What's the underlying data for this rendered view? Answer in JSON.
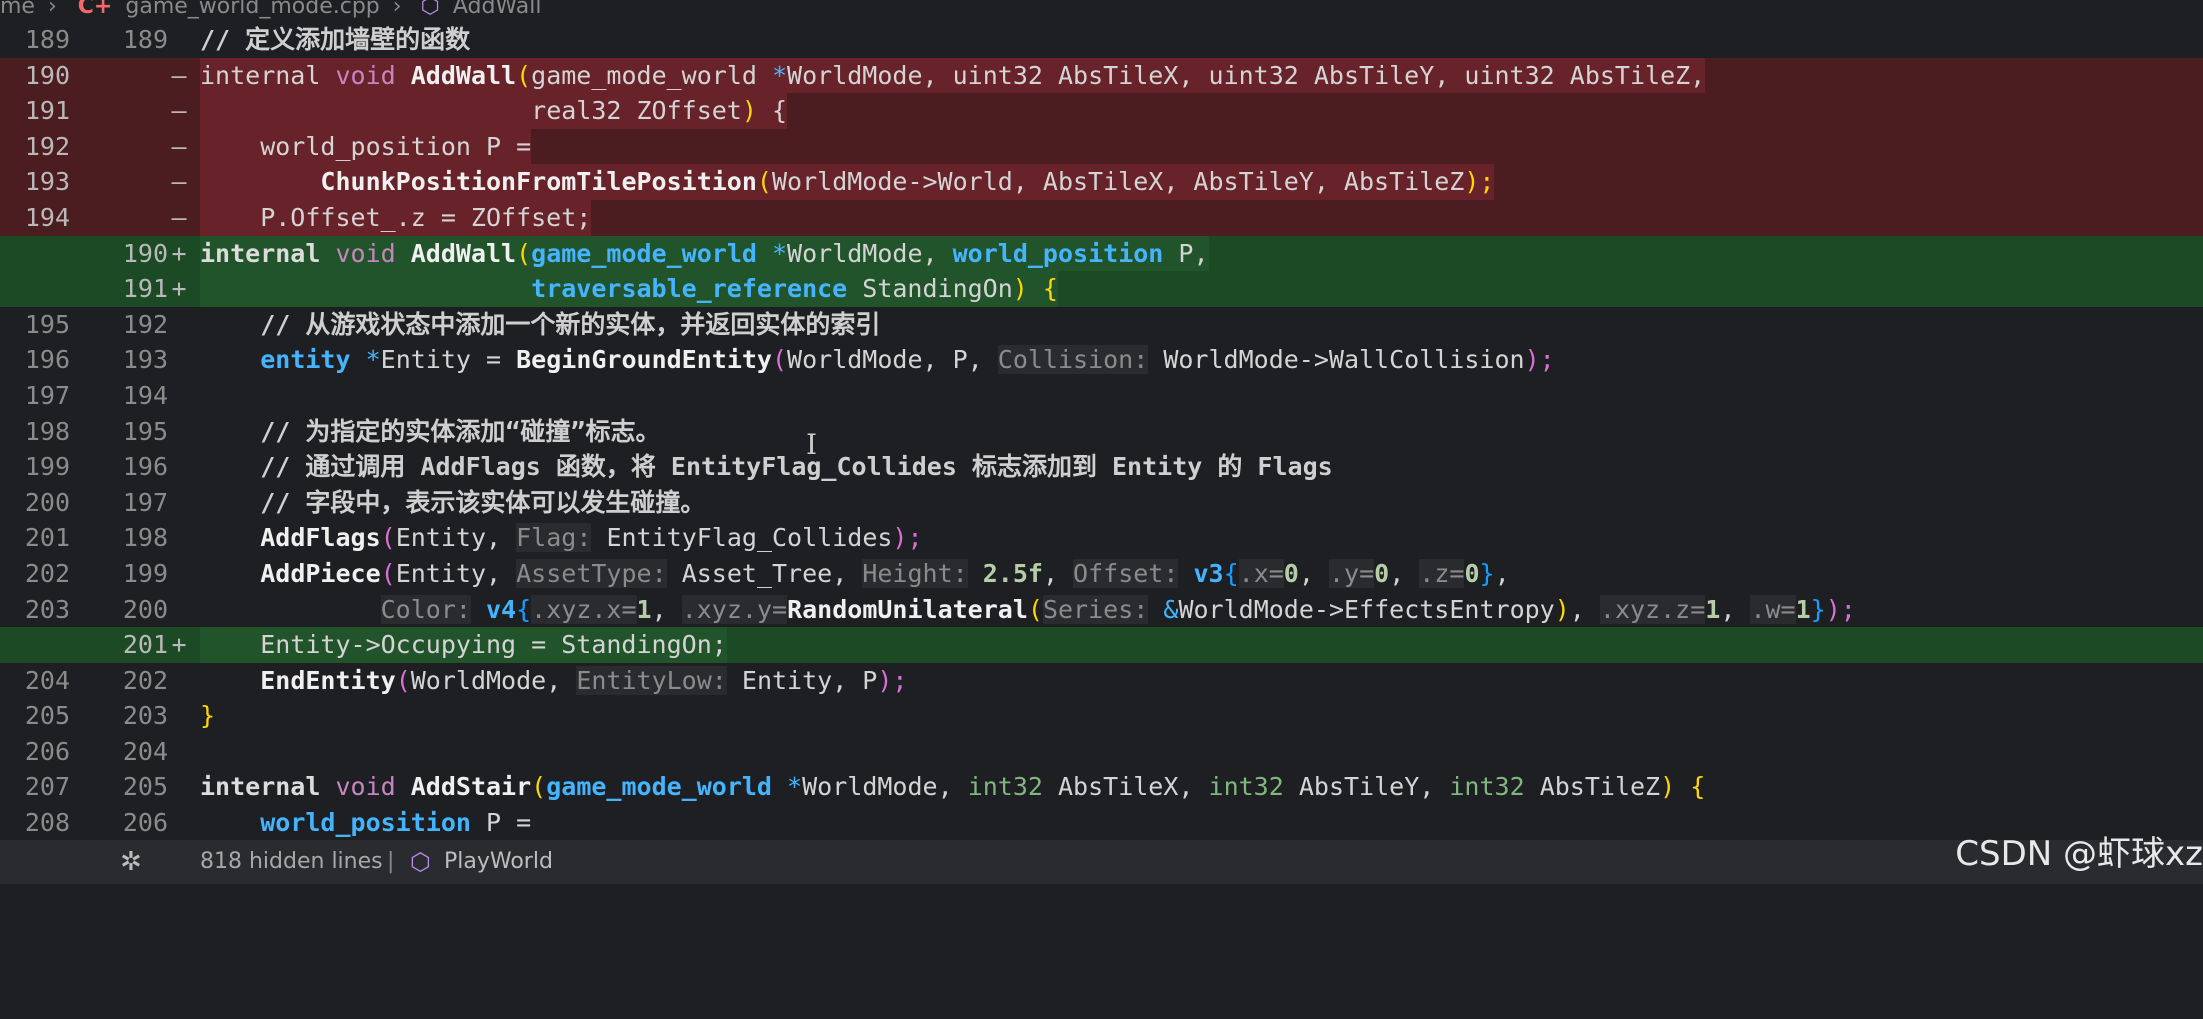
{
  "breadcrumb": {
    "prefix": "me",
    "sep1": "›",
    "file_icon": "C+",
    "file": "game_world_mode.cpp",
    "sep2": "›",
    "symbol": "AddWall"
  },
  "lines": [
    {
      "old": "189",
      "new": "189",
      "mark": "",
      "type": "ctx"
    },
    {
      "old": "190",
      "new": "",
      "mark": "—",
      "type": "del"
    },
    {
      "old": "191",
      "new": "",
      "mark": "—",
      "type": "del"
    },
    {
      "old": "192",
      "new": "",
      "mark": "—",
      "type": "del"
    },
    {
      "old": "193",
      "new": "",
      "mark": "—",
      "type": "del"
    },
    {
      "old": "194",
      "new": "",
      "mark": "—",
      "type": "del"
    },
    {
      "old": "",
      "new": "190",
      "mark": "+",
      "type": "add"
    },
    {
      "old": "",
      "new": "191",
      "mark": "+",
      "type": "add"
    },
    {
      "old": "195",
      "new": "192",
      "mark": "",
      "type": "ctx"
    },
    {
      "old": "196",
      "new": "193",
      "mark": "",
      "type": "ctx"
    },
    {
      "old": "197",
      "new": "194",
      "mark": "",
      "type": "ctx"
    },
    {
      "old": "198",
      "new": "195",
      "mark": "",
      "type": "ctx"
    },
    {
      "old": "199",
      "new": "196",
      "mark": "",
      "type": "ctx"
    },
    {
      "old": "200",
      "new": "197",
      "mark": "",
      "type": "ctx"
    },
    {
      "old": "201",
      "new": "198",
      "mark": "",
      "type": "ctx"
    },
    {
      "old": "202",
      "new": "199",
      "mark": "",
      "type": "ctx"
    },
    {
      "old": "203",
      "new": "200",
      "mark": "",
      "type": "ctx"
    },
    {
      "old": "",
      "new": "201",
      "mark": "+",
      "type": "add"
    },
    {
      "old": "204",
      "new": "202",
      "mark": "",
      "type": "ctx"
    },
    {
      "old": "205",
      "new": "203",
      "mark": "",
      "type": "ctx"
    },
    {
      "old": "206",
      "new": "204",
      "mark": "",
      "type": "ctx"
    },
    {
      "old": "207",
      "new": "205",
      "mark": "",
      "type": "ctx"
    },
    {
      "old": "208",
      "new": "206",
      "mark": "",
      "type": "ctx"
    }
  ],
  "code": {
    "l0": {
      "t0": "// 定义添加墙壁的函数"
    },
    "l1": {
      "t0": "internal",
      "t1": " void ",
      "t2": "AddWall",
      "t3": "(",
      "t4": "game_mode_world ",
      "t5": "*",
      "t6": "WorldMode, ",
      "t7": "uint32",
      "t8": " AbsTileX, ",
      "t9": "uint32",
      "t10": " AbsTileY, ",
      "t11": "uint32",
      "t12": " AbsTileZ,"
    },
    "l2": {
      "t0": "                      ",
      "t1": "real32",
      "t2": " ZOffset",
      "t3": ")",
      "t4": " {"
    },
    "l3": {
      "t0": "    world_position P ="
    },
    "l4": {
      "t0": "        ",
      "t1": "ChunkPositionFromTilePosition",
      "t2": "(",
      "t3": "WorldMode->World, AbsTileX, AbsTileY, AbsTileZ",
      "t4": ");"
    },
    "l5": {
      "t0": "    P.Offset_.z = ZOffset;"
    },
    "l6": {
      "t0": "internal",
      "t1": " void ",
      "t2": "AddWall",
      "t3": "(",
      "t4": "game_mode_world ",
      "t5": "*",
      "t6": "WorldMode, ",
      "t7": "world_position",
      "t8": " P,"
    },
    "l7": {
      "t0": "                      ",
      "t1": "traversable_reference",
      "t2": " StandingOn",
      "t3": ")",
      "t4": " {"
    },
    "l8": {
      "t0": "    // 从游戏状态中添加一个新的实体，并返回实体的索引"
    },
    "l9": {
      "t0": "    ",
      "t1": "entity ",
      "t2": "*",
      "t3": "Entity = ",
      "t4": "BeginGroundEntity",
      "t5": "(",
      "t6": "WorldMode, P, ",
      "t7": "Collision:",
      "t8": " WorldMode->WallCollision",
      "t9": ");"
    },
    "l10": {
      "t0": ""
    },
    "l11": {
      "t0": "    // 为指定的实体添加“碰撞”标志。"
    },
    "l12": {
      "t0": "    // 通过调用 AddFlags 函数，将 EntityFlag_Collides 标志添加到 Entity 的 Flags"
    },
    "l13": {
      "t0": "    // 字段中，表示该实体可以发生碰撞。"
    },
    "l14": {
      "t0": "    ",
      "t1": "AddFlags",
      "t2": "(",
      "t3": "Entity, ",
      "t4": "Flag:",
      "t5": " EntityFlag_Collides",
      "t6": ");"
    },
    "l15": {
      "t0": "    ",
      "t1": "AddPiece",
      "t2": "(",
      "t3": "Entity, ",
      "t4": "AssetType:",
      "t5": " Asset_Tree, ",
      "t6": "Height:",
      "t7": " 2.5f",
      "t8": ", ",
      "t9": "Offset:",
      "t10": " ",
      "t11": "v3",
      "t12": "{",
      "t13": ".x=",
      "t14": "0",
      ", ": "",
      "t15": ", ",
      "t16": ".y=",
      "t17": "0",
      "t18": ", ",
      "t19": ".z=",
      "t20": "0",
      "t21": "}",
      ",": "",
      "t22": ","
    },
    "l16": {
      "t0": "            ",
      "t1": "Color:",
      "t2": " ",
      "t3": "v4",
      "t4": "{",
      "t5": ".xyz.x=",
      "t6": "1",
      "t7": ", ",
      "t8": ".xyz.y=",
      "t9": "RandomUnilateral",
      "t10": "(",
      "t11": "Series:",
      "t12": " ",
      "t13": "&",
      "t14": "WorldMode->EffectsEntropy",
      "t15": ")",
      "t16": ", ",
      "t17": ".xyz.z=",
      "t18": "1",
      "t19": ", ",
      "t20": ".w=",
      "t21": "1",
      "t22": "}",
      "t23": ");"
    },
    "l17": {
      "t0": "    Entity->Occupying = StandingOn;"
    },
    "l18": {
      "t0": "    ",
      "t1": "EndEntity",
      "t2": "(",
      "t3": "WorldMode, ",
      "t4": "EntityLow:",
      "t5": " Entity, P",
      "t6": ");"
    },
    "l19": {
      "t0": "}"
    },
    "l20": {
      "t0": ""
    },
    "l21": {
      "t0": "internal",
      "t1": " void ",
      "t2": "AddStair",
      "t3": "(",
      "t4": "game_mode_world ",
      "t5": "*",
      "t6": "WorldMode, ",
      "t7": "int32",
      "t8": " AbsTileX, ",
      "t9": "int32",
      "t10": " AbsTileY, ",
      "t11": "int32",
      "t12": " AbsTileZ",
      "t13": ")",
      "t14": " {"
    },
    "l22": {
      "t0": "    ",
      "t1": "world_position",
      "t2": " P ="
    }
  },
  "fold": {
    "icon": "✲",
    "text": "818 hidden lines",
    "sep": "|",
    "cube": "⬡",
    "function": "PlayWorld"
  },
  "watermark": "CSDN @虾球xz",
  "cursor": "I"
}
